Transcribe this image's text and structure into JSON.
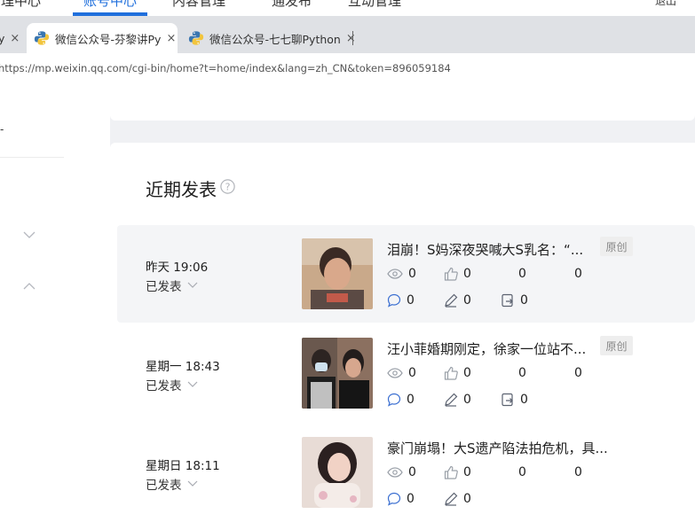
{
  "top_nav": {
    "items": [
      {
        "label": "管理中心",
        "active": false
      },
      {
        "label": "账号中心",
        "active": true
      },
      {
        "label": "内容管理",
        "active": false
      },
      {
        "label": "通发布",
        "active": false
      },
      {
        "label": "互动管理",
        "active": false
      },
      {
        "label": "退出",
        "active": false
      }
    ],
    "accent_color": "#1f6fdc"
  },
  "tabs": [
    {
      "label": "y",
      "icon": "close-icon"
    },
    {
      "label": "微信公众号-芬黎讲Py",
      "icon": "python-icon",
      "active": true,
      "close": "×"
    },
    {
      "label": "微信公众号-七七聊Python",
      "icon": "python-icon",
      "active": false,
      "close": "×"
    }
  ],
  "address_bar": {
    "url": "https://mp.weixin.qq.com/cgi-bin/home?t=home/index&lang=zh_CN&token=896059184"
  },
  "sidebar": {
    "dash": "-",
    "icons": [
      "chevron-down-icon",
      "chevron-up-icon"
    ]
  },
  "recent": {
    "title": "近期发表",
    "help_icon": "help-circle-icon",
    "posts": [
      {
        "time": "昨天 19:06",
        "status": "已发表",
        "title": "泪崩！S妈深夜哭喊大S乳名：“...",
        "badge": "原创",
        "views": "0",
        "likes": "0",
        "shares": "0",
        "favorites": "0",
        "comments": "0",
        "notes": "0",
        "forwards": "0"
      },
      {
        "time": "星期一 18:43",
        "status": "已发表",
        "title": "汪小菲婚期刚定，徐家一位站不...",
        "badge": "原创",
        "views": "0",
        "likes": "0",
        "shares": "0",
        "favorites": "0",
        "comments": "0",
        "notes": "0",
        "forwards": "0"
      },
      {
        "time": "星期日 18:11",
        "status": "已发表",
        "title": "豪门崩塌！大S遗产陷法拍危机，具...",
        "badge": "",
        "views": "0",
        "likes": "0",
        "shares": "0",
        "favorites": "0",
        "comments": "0",
        "notes": "0"
      }
    ]
  }
}
